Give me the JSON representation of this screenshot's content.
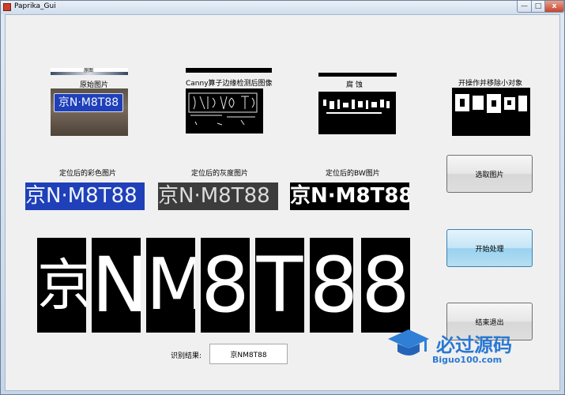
{
  "window": {
    "title": "Paprika_Gui",
    "min_glyph": "—",
    "max_glyph": "□",
    "close_glyph": "x"
  },
  "panels": {
    "original_caption": "原始图片",
    "original_tab": "原图",
    "canny_caption": "Canny算子边缘检测后图像",
    "erode_caption": "腐    蚀",
    "open_caption": "开操作并移除小对象",
    "color_caption": "定位后的彩色图片",
    "gray_caption": "定位后的灰度图片",
    "bw_caption": "定位后的BW图片"
  },
  "plate": {
    "text": "京N·M8T88",
    "chars": [
      "京",
      "N",
      "M",
      "8",
      "T",
      "8",
      "8"
    ]
  },
  "buttons": {
    "select_label": "选取图片",
    "process_label": "开始处理",
    "exit_label": "结束退出"
  },
  "result": {
    "label": "识别结果:",
    "value": "京NM8T88"
  },
  "watermark": {
    "brand": "必过源码",
    "url": "Biguo100.com"
  },
  "colors": {
    "plate_blue": "#1f40b8",
    "button_focus": "#98d1ef",
    "window_frame": "#c9d8ea"
  }
}
